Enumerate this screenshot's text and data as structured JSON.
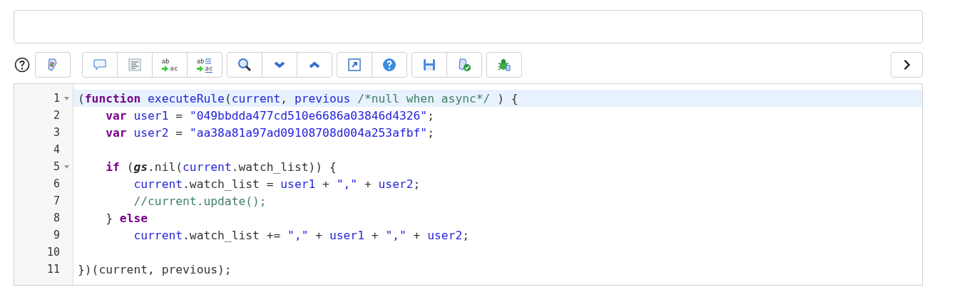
{
  "toolbar": {
    "replace": {
      "from": "ab",
      "to": "ac"
    },
    "replace_all": {
      "from": "ab",
      "to": "ac"
    }
  },
  "editor": {
    "lines": [
      {
        "number": "1",
        "foldable": true,
        "active": true,
        "tokens": [
          {
            "kind": "plain",
            "text": "("
          },
          {
            "kind": "keyword",
            "text": "function"
          },
          {
            "kind": "variable",
            "text": " executeRule"
          },
          {
            "kind": "plain",
            "text": "("
          },
          {
            "kind": "variable",
            "text": "current"
          },
          {
            "kind": "plain",
            "text": ", "
          },
          {
            "kind": "variable",
            "text": "previous"
          },
          {
            "kind": "comment",
            "text": " /*null when async*/"
          },
          {
            "kind": "plain",
            "text": " ) {"
          }
        ]
      },
      {
        "number": "2",
        "foldable": false,
        "active": false,
        "tokens": [
          {
            "kind": "keyword",
            "text": "    var"
          },
          {
            "kind": "variable",
            "text": " user1"
          },
          {
            "kind": "plain",
            "text": " = "
          },
          {
            "kind": "string",
            "text": "\"049bbdda477cd510e6686a03846d4326\""
          },
          {
            "kind": "plain",
            "text": ";"
          }
        ]
      },
      {
        "number": "3",
        "foldable": false,
        "active": false,
        "tokens": [
          {
            "kind": "keyword",
            "text": "    var"
          },
          {
            "kind": "variable",
            "text": " user2"
          },
          {
            "kind": "plain",
            "text": " = "
          },
          {
            "kind": "string",
            "text": "\"aa38a81a97ad09108708d004a253afbf\""
          },
          {
            "kind": "plain",
            "text": ";"
          }
        ]
      },
      {
        "number": "4",
        "foldable": false,
        "active": false
      },
      {
        "number": "5",
        "foldable": true,
        "active": false,
        "tokens": [
          {
            "kind": "keyword",
            "text": "    if"
          },
          {
            "kind": "plain",
            "text": " ("
          },
          {
            "kind": "builtin",
            "text": "gs"
          },
          {
            "kind": "plain",
            "text": ".nil("
          },
          {
            "kind": "variable",
            "text": "current"
          },
          {
            "kind": "plain",
            "text": ".watch_list)) {"
          }
        ]
      },
      {
        "number": "6",
        "foldable": false,
        "active": false,
        "tokens": [
          {
            "kind": "variable",
            "text": "        current"
          },
          {
            "kind": "plain",
            "text": ".watch_list = "
          },
          {
            "kind": "variable",
            "text": "user1"
          },
          {
            "kind": "plain",
            "text": " + "
          },
          {
            "kind": "string",
            "text": "\",\""
          },
          {
            "kind": "plain",
            "text": " + "
          },
          {
            "kind": "variable",
            "text": "user2"
          },
          {
            "kind": "plain",
            "text": ";"
          }
        ]
      },
      {
        "number": "7",
        "foldable": false,
        "active": false,
        "tokens": [
          {
            "kind": "comment",
            "text": "        //current.update();"
          }
        ]
      },
      {
        "number": "8",
        "foldable": false,
        "active": false,
        "tokens": [
          {
            "kind": "plain",
            "text": "    } "
          },
          {
            "kind": "keyword",
            "text": "else"
          }
        ]
      },
      {
        "number": "9",
        "foldable": false,
        "active": false,
        "tokens": [
          {
            "kind": "variable",
            "text": "        current"
          },
          {
            "kind": "plain",
            "text": ".watch_list += "
          },
          {
            "kind": "string",
            "text": "\",\""
          },
          {
            "kind": "plain",
            "text": " + "
          },
          {
            "kind": "variable",
            "text": "user1"
          },
          {
            "kind": "plain",
            "text": " + "
          },
          {
            "kind": "string",
            "text": "\",\""
          },
          {
            "kind": "plain",
            "text": " + "
          },
          {
            "kind": "variable",
            "text": "user2"
          },
          {
            "kind": "plain",
            "text": ";"
          }
        ]
      },
      {
        "number": "10",
        "foldable": false,
        "active": false
      },
      {
        "number": "11",
        "foldable": false,
        "active": false,
        "tokens": [
          {
            "kind": "plain",
            "text": "})(current, previous);"
          }
        ]
      }
    ]
  }
}
